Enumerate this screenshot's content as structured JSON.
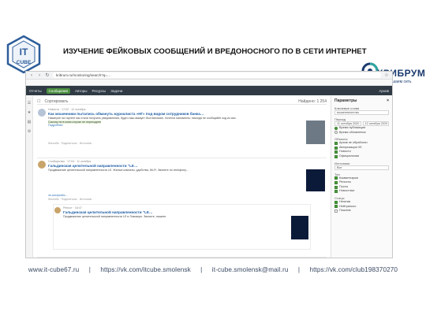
{
  "slide": {
    "title": "ИЗУЧЕНИЕ ФЕЙКОВЫХ СООБЩЕНИЙ И ВРЕДОНОСНОГО ПО В СЕТИ ИНТЕРНЕТ",
    "logo_left_text": "IT CUBE",
    "logo_right_brand": "КРИБРУМ",
    "logo_right_tagline": "Мы слушаем сеть"
  },
  "browser": {
    "url": "kribrum.ru/monitoring/search?q=…",
    "nav": {
      "tabs": [
        "Отчеты",
        "Сообщения",
        "Авторы",
        "Ресурсы",
        "Задачи"
      ],
      "active_tab": "Сообщения",
      "user": "Архив"
    },
    "toolbar": {
      "sort": "Сортировать",
      "total": "Найдено: 1 254"
    },
    "posts": [
      {
        "meta": "Новости · 17:02 · 12 октября",
        "title": "Как мошенники пытались обмануть журналиста «НГ» под видом сотрудников банка…",
        "text": "Накануне на таргете мы стали получать уведомления, будто наш аккаунт был взломан. Хочется напомнить: никогда не сообщайте код из смс.",
        "highlight": "Ссылку ни в коем случае не переходите",
        "link": "Подробнее",
        "footer": "Жалоба · Поделиться · Источник"
      },
      {
        "meta": "Сообщество · 17:04 · 11 октября",
        "title": "Гальдинская целительной направленности \"LE…",
        "text": "Продвижение целительской направленности LE. Жилые комнаты, удобства, Wi-Fi. Звоните по телефону…",
        "link": "vk.com/public…",
        "footer": "Жалоба · Поделиться · Источник",
        "repost": {
          "meta": "Репост · 16:47",
          "title": "Гальдинская целительной направленности \"LE…",
          "text": "Продвижение целительской направленности LE в Ловозере. Звоните, пишите."
        }
      }
    ],
    "panel": {
      "title": "Параметры",
      "keywords_label": "Ключевые слова",
      "keywords_value": "мошенничество",
      "period_label": "Период",
      "date_from": "11 октября 2020",
      "date_to": "12 октября 2020",
      "scope_options": [
        "Время публикации",
        "Время обновления"
      ],
      "objects_label": "Объекты",
      "objects": [
        {
          "label": "Архив не обработан",
          "checked": true
        },
        {
          "label": "Авторизация VK",
          "checked": true
        },
        {
          "label": "Новости",
          "checked": true
        },
        {
          "label": "Официальная",
          "checked": true
        }
      ],
      "source_label": "Источники",
      "source_value": "Все",
      "types_label": "Тип",
      "types": [
        {
          "label": "Комментарии",
          "checked": true
        },
        {
          "label": "Репосты",
          "checked": true
        },
        {
          "label": "Посты",
          "checked": true
        },
        {
          "label": "Новостные",
          "checked": true
        }
      ],
      "status_label": "Статус",
      "statuses": [
        {
          "label": "Негатив",
          "checked": true
        },
        {
          "label": "Нейтрально",
          "checked": true
        },
        {
          "label": "Позитив",
          "checked": false
        }
      ]
    }
  },
  "footer": {
    "site": "www.it-cube67.ru",
    "vk_itcube": "https://vk.com/itcube.smolensk",
    "email": "it-cube.smolensk@mail.ru",
    "vk_club": "https://vk.com/club198370270",
    "separator": "|"
  },
  "colors": {
    "nav_bg": "#2f3a44",
    "accent_green": "#4a8f3f",
    "link_blue": "#1f5fa6",
    "brand_navy": "#1b3b6f",
    "footer_text": "#3b4a63"
  }
}
